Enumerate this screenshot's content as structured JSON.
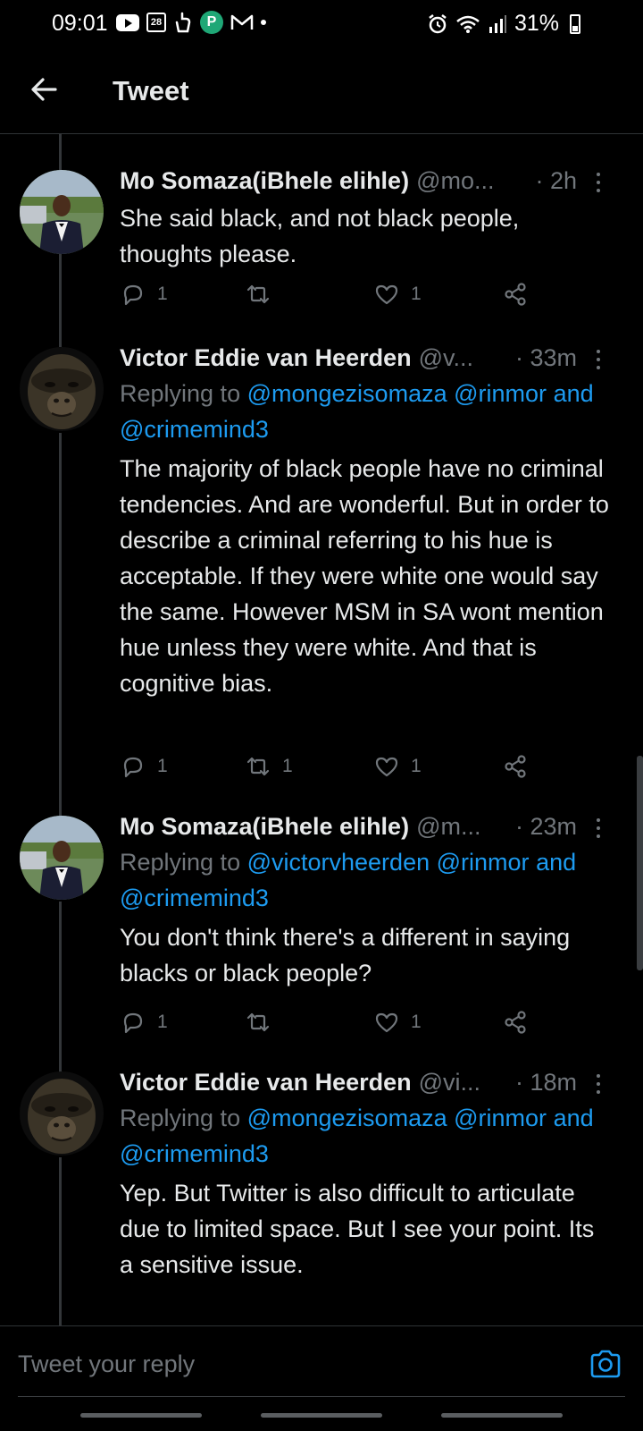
{
  "status": {
    "time": "09:01",
    "calendar_day": "28",
    "battery": "31%",
    "left_icons": [
      "youtube-icon",
      "calendar-icon",
      "hand-icon",
      "app-icon",
      "gmail-icon",
      "dot-icon"
    ],
    "right_icons": [
      "alarm-icon",
      "wifi-icon",
      "signal-icon",
      "battery-icon"
    ]
  },
  "header": {
    "title": "Tweet"
  },
  "tweets": [
    {
      "name": "Mo Somaza(iBhele elihle)",
      "handle": "@mo...",
      "time": "· 2h",
      "text": "She said black, and not black people, thoughts please.",
      "reply_count": "1",
      "retweet_count": "",
      "like_count": "1"
    },
    {
      "name": "Victor Eddie van Heerden",
      "handle": "@v...",
      "time": "· 33m",
      "replying_prefix": "Replying to ",
      "mention_1": "@mongezisomaza",
      "mention_2": "@rinmor",
      "and_word": "and",
      "mention_3": "@crimemind3",
      "text": "The majority of black people have no criminal tendencies. And are wonderful. But in order to describe a criminal referring to his hue is acceptable. If they were white one would say the same. However MSM in SA wont mention hue unless they were white. And that is cognitive bias.",
      "reply_count": "1",
      "retweet_count": "1",
      "like_count": "1"
    },
    {
      "name": "Mo Somaza(iBhele elihle)",
      "handle": "@m...",
      "time": "· 23m",
      "replying_prefix": "Replying to ",
      "mention_1": "@victorvheerden",
      "mention_2": "@rinmor",
      "and_word": "and",
      "mention_3": "@crimemind3",
      "text": "You don't think there's a different in saying blacks or black people?",
      "reply_count": "1",
      "retweet_count": "",
      "like_count": "1"
    },
    {
      "name": "Victor Eddie van Heerden",
      "handle": "@vi...",
      "time": "· 18m",
      "replying_prefix": "Replying to ",
      "mention_1": "@mongezisomaza",
      "mention_2": "@rinmor",
      "and_word": "and",
      "mention_3": "@crimemind3",
      "text": "Yep. But Twitter is also difficult to articulate due to limited space. But I see your point. Its a sensitive issue."
    }
  ],
  "reply_bar": {
    "placeholder": "Tweet your reply"
  },
  "colors": {
    "background": "#000000",
    "text": "#e7e9ea",
    "muted": "#71767b",
    "accent": "#1d9bf0"
  }
}
